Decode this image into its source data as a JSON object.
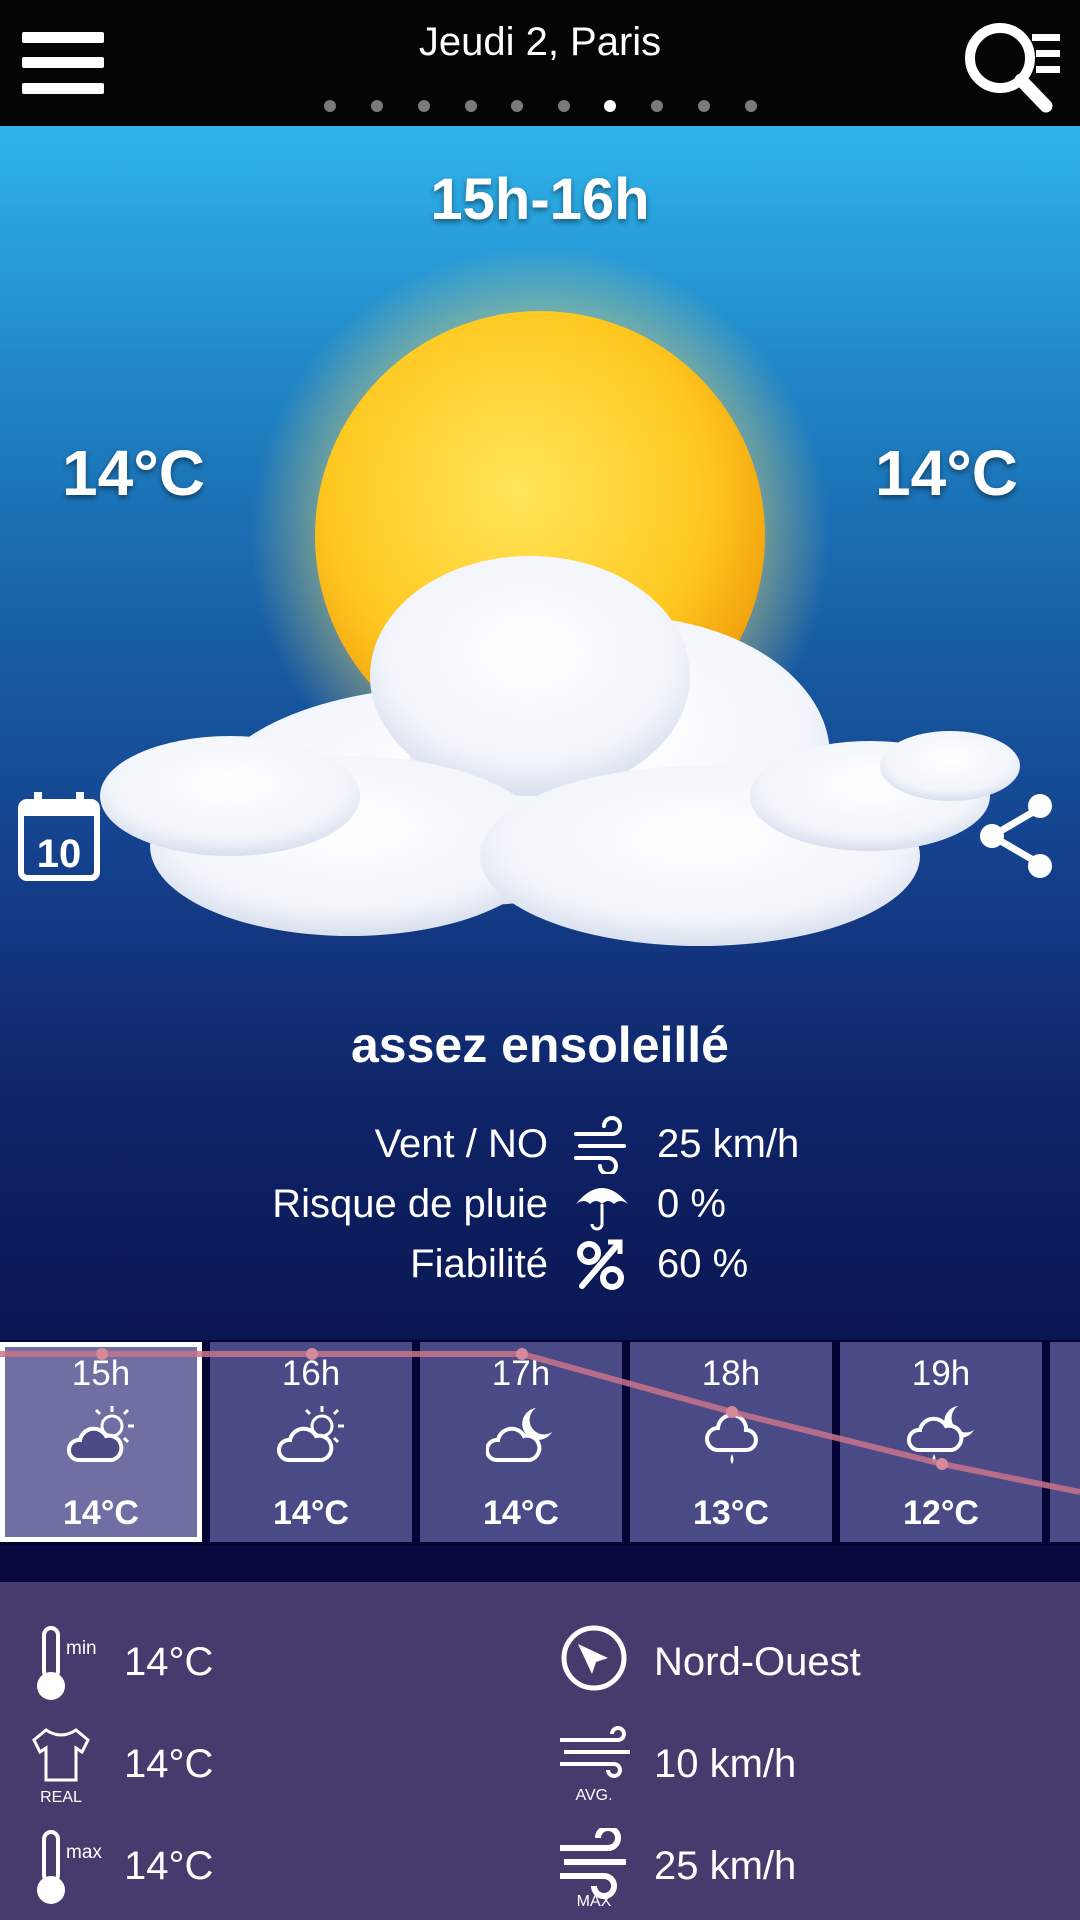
{
  "header": {
    "title": "Jeudi 2, Paris",
    "page_count": 10,
    "active_page": 7
  },
  "hero": {
    "time_slot": "15h-16h",
    "temp_left": "14°C",
    "temp_right": "14°C",
    "calendar_day": "10",
    "condition": "assez ensoleillé",
    "details": [
      {
        "label": "Vent / NO",
        "icon": "wind-icon",
        "value": "25 km/h"
      },
      {
        "label": "Risque de pluie",
        "icon": "umbrella-icon",
        "value": "0 %"
      },
      {
        "label": "Fiabilité",
        "icon": "percent-icon",
        "value": "60 %"
      }
    ]
  },
  "hourly": [
    {
      "hour": "15h",
      "icon": "sun-cloud-icon",
      "temp": "14°C",
      "selected": true
    },
    {
      "hour": "16h",
      "icon": "sun-cloud-icon",
      "temp": "14°C"
    },
    {
      "hour": "17h",
      "icon": "moon-cloud-icon",
      "temp": "14°C"
    },
    {
      "hour": "18h",
      "icon": "rain-cloud-icon",
      "temp": "13°C"
    },
    {
      "hour": "19h",
      "icon": "moon-rain-cloud-icon",
      "temp": "12°C"
    }
  ],
  "stats": {
    "temp_min": {
      "icon": "thermometer-min-icon",
      "badge": "min",
      "value": "14°C"
    },
    "temp_real": {
      "icon": "shirt-icon",
      "badge": "REAL",
      "value": "14°C"
    },
    "temp_max": {
      "icon": "thermometer-max-icon",
      "badge": "max",
      "value": "14°C"
    },
    "wind_direction": {
      "icon": "compass-icon",
      "value": "Nord-Ouest"
    },
    "wind_avg": {
      "icon": "wind-avg-icon",
      "badge": "AVG.",
      "value": "10 km/h"
    },
    "wind_max": {
      "icon": "wind-max-icon",
      "badge": "MAX",
      "value": "25 km/h"
    }
  },
  "colors": {
    "topbar": "#050505",
    "hour_card": "#4a4a86",
    "panel": "#473b6e",
    "trend_line": "#c8738a"
  }
}
